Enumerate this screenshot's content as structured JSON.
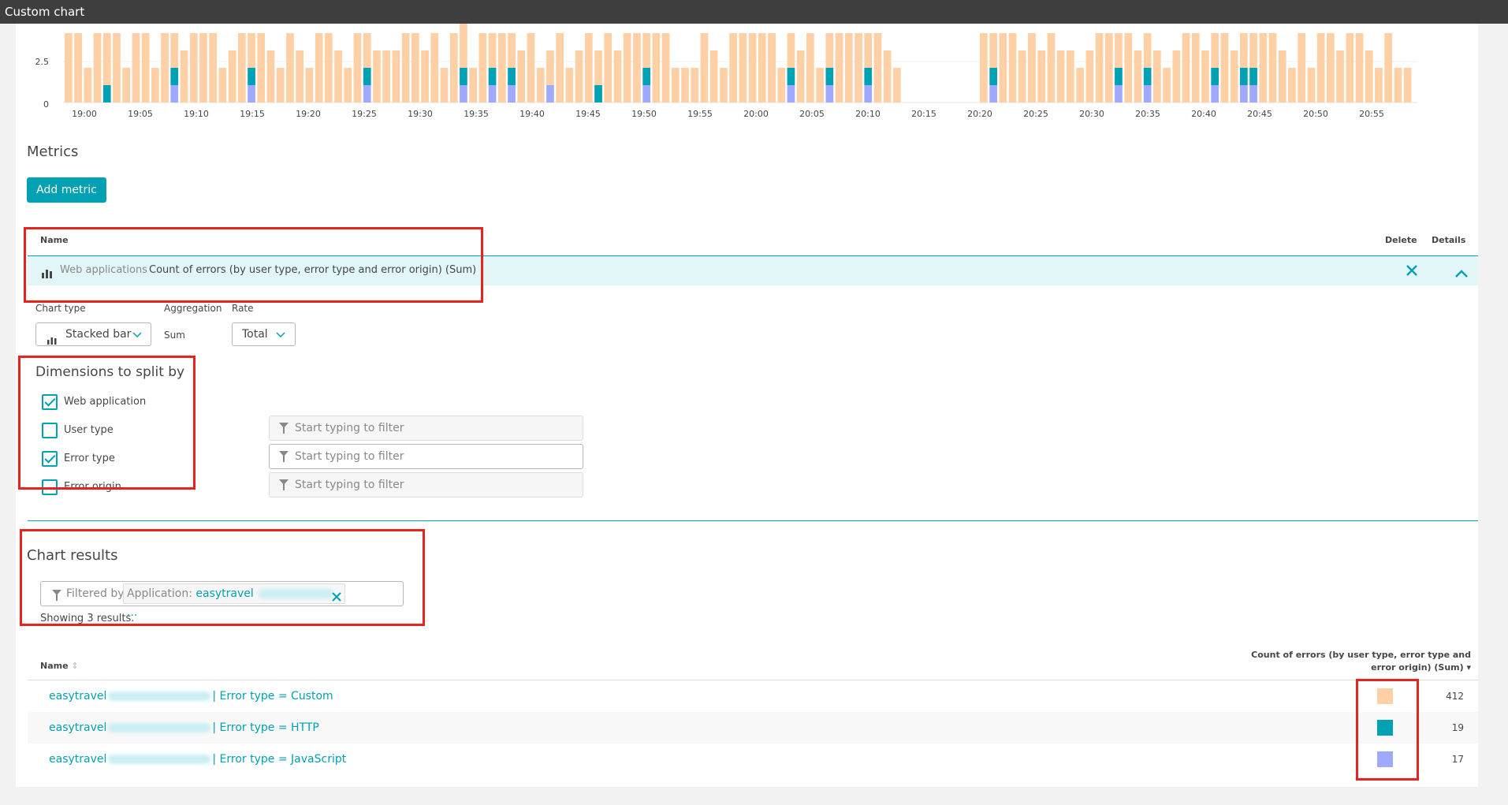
{
  "window": {
    "title": "Custom chart"
  },
  "chart_data": {
    "type": "bar",
    "stacked": true,
    "y_ticks": [
      "2.5",
      "0"
    ],
    "ylim": [
      0,
      4.5
    ],
    "x_ticks": [
      "19:00",
      "19:05",
      "19:10",
      "19:15",
      "19:20",
      "19:25",
      "19:30",
      "19:35",
      "19:40",
      "19:45",
      "19:50",
      "19:55",
      "20:00",
      "20:05",
      "20:10",
      "20:15",
      "20:20",
      "20:25",
      "20:30",
      "20:35",
      "20:40",
      "20:45",
      "20:50",
      "20:55"
    ],
    "series_colors": {
      "custom": "#ffcfa6",
      "http": "#00a1b2",
      "javascript": "#9ea9ff"
    },
    "bars": [
      [
        4,
        0,
        0
      ],
      [
        4,
        0,
        0
      ],
      [
        2,
        0,
        0
      ],
      [
        4,
        0,
        0
      ],
      [
        3,
        1,
        0
      ],
      [
        4,
        0,
        0
      ],
      [
        2,
        0,
        0
      ],
      [
        4,
        0,
        0
      ],
      [
        4,
        0,
        0
      ],
      [
        2,
        0,
        0
      ],
      [
        4,
        0,
        0
      ],
      [
        2,
        1,
        1
      ],
      [
        3,
        0,
        0
      ],
      [
        4,
        0,
        0
      ],
      [
        4,
        0,
        0
      ],
      [
        4,
        0,
        0
      ],
      [
        2,
        0,
        0
      ],
      [
        3,
        0,
        0
      ],
      [
        4,
        0,
        0
      ],
      [
        2,
        1,
        1
      ],
      [
        4,
        0,
        0
      ],
      [
        3,
        0,
        0
      ],
      [
        2,
        0,
        0
      ],
      [
        4,
        0,
        0
      ],
      [
        3,
        0,
        0
      ],
      [
        2,
        0,
        0
      ],
      [
        4,
        0,
        0
      ],
      [
        4,
        0,
        0
      ],
      [
        3,
        0,
        0
      ],
      [
        2,
        0,
        0
      ],
      [
        4,
        0,
        0
      ],
      [
        2,
        1,
        1
      ],
      [
        3,
        0,
        0
      ],
      [
        3,
        0,
        0
      ],
      [
        3,
        0,
        0
      ],
      [
        4,
        0,
        0
      ],
      [
        4,
        0,
        0
      ],
      [
        3,
        0,
        0
      ],
      [
        4,
        0,
        0
      ],
      [
        2,
        0,
        0
      ],
      [
        4,
        0,
        0
      ],
      [
        3,
        1,
        1
      ],
      [
        2,
        0,
        0
      ],
      [
        4,
        0,
        0
      ],
      [
        2,
        1,
        1
      ],
      [
        4,
        0,
        0
      ],
      [
        2,
        1,
        1
      ],
      [
        3,
        0,
        0
      ],
      [
        4,
        0,
        0
      ],
      [
        2,
        0,
        0
      ],
      [
        2,
        0,
        1
      ],
      [
        4,
        0,
        0
      ],
      [
        2,
        0,
        0
      ],
      [
        3,
        0,
        0
      ],
      [
        4,
        0,
        0
      ],
      [
        2,
        1,
        0
      ],
      [
        4,
        0,
        0
      ],
      [
        3,
        0,
        0
      ],
      [
        4,
        0,
        0
      ],
      [
        4,
        0,
        0
      ],
      [
        2,
        1,
        1
      ],
      [
        4,
        0,
        0
      ],
      [
        4,
        0,
        0
      ],
      [
        2,
        0,
        0
      ],
      [
        2,
        0,
        0
      ],
      [
        2,
        0,
        0
      ],
      [
        4,
        0,
        0
      ],
      [
        3,
        0,
        0
      ],
      [
        2,
        0,
        0
      ],
      [
        4,
        0,
        0
      ],
      [
        4,
        0,
        0
      ],
      [
        4,
        0,
        0
      ],
      [
        4,
        0,
        0
      ],
      [
        4,
        0,
        0
      ],
      [
        2,
        0,
        0
      ],
      [
        2,
        1,
        1
      ],
      [
        3,
        0,
        0
      ],
      [
        4,
        0,
        0
      ],
      [
        2,
        0,
        0
      ],
      [
        2,
        1,
        1
      ],
      [
        4,
        0,
        0
      ],
      [
        4,
        0,
        0
      ],
      [
        4,
        0,
        0
      ],
      [
        2,
        1,
        1
      ],
      [
        4,
        0,
        0
      ],
      [
        3,
        0,
        0
      ],
      [
        2,
        0,
        0
      ],
      [
        0,
        0,
        0
      ],
      [
        0,
        0,
        0
      ],
      [
        0,
        0,
        0
      ],
      [
        0,
        0,
        0
      ],
      [
        0,
        0,
        0
      ],
      [
        0,
        0,
        0
      ],
      [
        0,
        0,
        0
      ],
      [
        0,
        0,
        0
      ],
      [
        4,
        0,
        0
      ],
      [
        2,
        1,
        1
      ],
      [
        4,
        0,
        0
      ],
      [
        4,
        0,
        0
      ],
      [
        3,
        0,
        0
      ],
      [
        4,
        0,
        0
      ],
      [
        3,
        0,
        0
      ],
      [
        4,
        0,
        0
      ],
      [
        3,
        0,
        0
      ],
      [
        3,
        0,
        0
      ],
      [
        2,
        0,
        0
      ],
      [
        3,
        0,
        0
      ],
      [
        4,
        0,
        0
      ],
      [
        4,
        0,
        0
      ],
      [
        2,
        1,
        1
      ],
      [
        4,
        0,
        0
      ],
      [
        3,
        0,
        0
      ],
      [
        2,
        1,
        1
      ],
      [
        3,
        0,
        0
      ],
      [
        2,
        0,
        0
      ],
      [
        3,
        0,
        0
      ],
      [
        4,
        0,
        0
      ],
      [
        4,
        0,
        0
      ],
      [
        3,
        0,
        0
      ],
      [
        2,
        1,
        1
      ],
      [
        4,
        0,
        0
      ],
      [
        3,
        0,
        0
      ],
      [
        2,
        1,
        1
      ],
      [
        2,
        1,
        1
      ],
      [
        4,
        0,
        0
      ],
      [
        4,
        0,
        0
      ],
      [
        3,
        0,
        0
      ],
      [
        2,
        0,
        0
      ],
      [
        4,
        0,
        0
      ],
      [
        2,
        0,
        0
      ],
      [
        4,
        0,
        0
      ],
      [
        4,
        0,
        0
      ],
      [
        3,
        0,
        0
      ],
      [
        4,
        0,
        0
      ],
      [
        4,
        0,
        0
      ],
      [
        3,
        0,
        0
      ],
      [
        2,
        0,
        0
      ],
      [
        4,
        0,
        0
      ],
      [
        2,
        0,
        0
      ],
      [
        2,
        0,
        0
      ]
    ]
  },
  "metrics": {
    "heading": "Metrics",
    "add_button": "Add metric",
    "col_name": "Name",
    "col_delete": "Delete",
    "col_details": "Details",
    "row": {
      "source": "Web applications",
      "name": "Count of errors (by user type, error type and error origin) (Sum)"
    }
  },
  "settings": {
    "chart_type_label": "Chart type",
    "chart_type_value": "Stacked bar",
    "aggregation_label": "Aggregation",
    "aggregation_value": "Sum",
    "rate_label": "Rate",
    "rate_value": "Total"
  },
  "dimensions": {
    "heading": "Dimensions to split by",
    "items": [
      {
        "label": "Web application",
        "checked": true
      },
      {
        "label": "User type",
        "checked": false
      },
      {
        "label": "Error type",
        "checked": true
      },
      {
        "label": "Error origin",
        "checked": false
      }
    ],
    "filter_placeholder": "Start typing to filter"
  },
  "results": {
    "heading": "Chart results",
    "filtered_by": "Filtered by",
    "filter_chip_key": "Application:",
    "filter_chip_value": "easytravel",
    "filter_chip_ellipsis": "...",
    "showing": "Showing 3 results.",
    "col_name": "Name",
    "col_value_line1": "Count of errors (by user type, error type and",
    "col_value_line2": "error origin) (Sum) ▾",
    "rows": [
      {
        "app": "easytravel",
        "suffix": "| Error type = Custom",
        "color": "#ffcfa6",
        "value": "412"
      },
      {
        "app": "easytravel",
        "suffix": "| Error type = HTTP",
        "color": "#00a1b2",
        "value": "19"
      },
      {
        "app": "easytravel",
        "suffix": "| Error type = JavaScript",
        "color": "#9ea9ff",
        "value": "17"
      }
    ]
  }
}
